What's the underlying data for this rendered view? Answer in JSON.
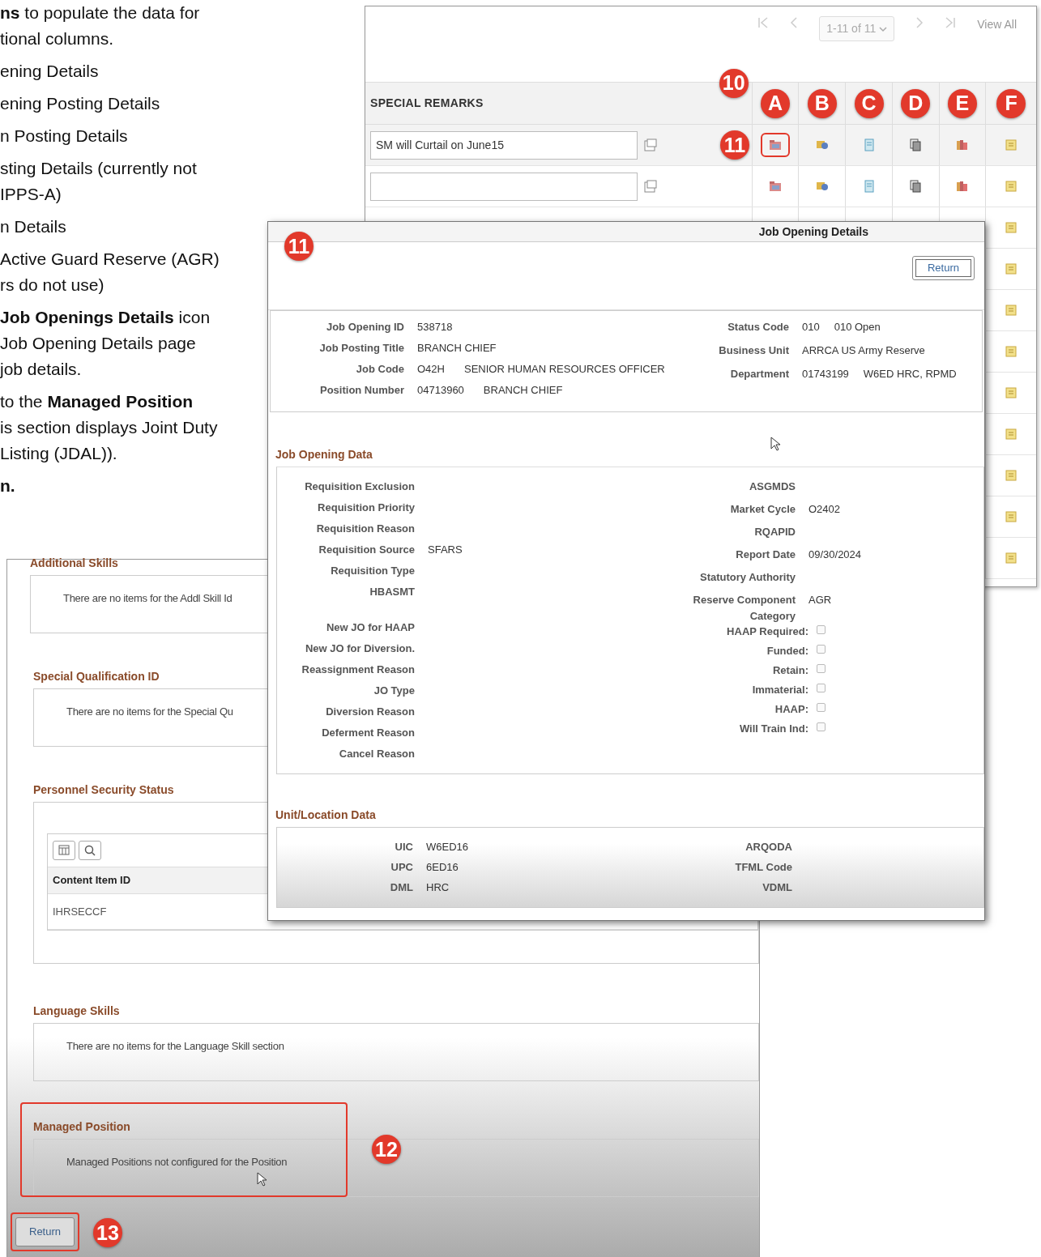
{
  "instructions": [
    {
      "lines": [
        "**ns** to populate the data for",
        "tional columns."
      ]
    },
    {
      "lines": [
        "ening Details"
      ]
    },
    {
      "lines": [
        "ening Posting Details"
      ]
    },
    {
      "lines": [
        "n Posting Details"
      ]
    },
    {
      "lines": [
        "sting Details (currently not",
        "IPPS-A)"
      ]
    },
    {
      "lines": [
        "n Details"
      ]
    },
    {
      "lines": [
        "Active Guard Reserve (AGR)",
        "rs do not use)"
      ]
    },
    {
      "lines": [
        "**Job Openings Details** icon",
        "Job Opening Details page",
        "job details."
      ]
    },
    {
      "lines": [
        "to the **Managed Position**",
        "is section displays Joint Duty",
        "Listing (JDAL))."
      ]
    },
    {
      "lines": [
        "**n.**"
      ]
    }
  ],
  "remarks_grid": {
    "pager": {
      "range": "1-11 of 11",
      "view_all": "View All"
    },
    "callout": "10",
    "header": "SPECIAL REMARKS",
    "columns": [
      "A",
      "B",
      "C",
      "D",
      "E",
      "F"
    ],
    "rows": [
      {
        "kind": "remark",
        "value": "SM will Curtail on June15",
        "callout": "11"
      },
      {
        "kind": "remark"
      },
      {
        "kind": "partial"
      },
      {
        "kind": "partial"
      },
      {
        "kind": "partial"
      },
      {
        "kind": "partial"
      },
      {
        "kind": "partial"
      },
      {
        "kind": "partial"
      },
      {
        "kind": "partial"
      },
      {
        "kind": "partial"
      },
      {
        "kind": "partial"
      }
    ]
  },
  "position_sections": {
    "sections": [
      {
        "title": "Additional Skills",
        "kind": "message",
        "message": "There are no items for the Addl Skill Id"
      },
      {
        "title": "Special Qualification ID",
        "kind": "message",
        "message": "There are no items for the Special Qu"
      },
      {
        "title": "Personnel Security Status",
        "kind": "grid",
        "column": "Content Item ID",
        "rows": [
          "IHRSECCF"
        ]
      },
      {
        "title": "Language Skills",
        "kind": "message",
        "message": "There are no items for the Language Skill section"
      },
      {
        "title": "Managed Position",
        "kind": "message",
        "message": "Managed Positions not configured for the Position",
        "callout": "12"
      }
    ],
    "return_button": {
      "label": "Return",
      "callout": "13"
    }
  },
  "job_opening_details": {
    "title": "Job Opening Details",
    "callout": "11",
    "return_button": "Return",
    "header_left": [
      {
        "label": "Job Opening ID",
        "values": [
          "538718"
        ]
      },
      {
        "label": "Job Posting Title",
        "values": [
          "BRANCH CHIEF"
        ]
      },
      {
        "label": "Job Code",
        "values": [
          "O42H",
          "SENIOR HUMAN RESOURCES OFFICER"
        ]
      },
      {
        "label": "Position Number",
        "values": [
          "04713960",
          "BRANCH CHIEF"
        ]
      }
    ],
    "header_right": [
      {
        "label": "Status Code",
        "values": [
          "010",
          "010 Open"
        ]
      },
      {
        "label": "Business Unit",
        "values": [
          "ARRCA US Army Reserve"
        ]
      },
      {
        "label": "Department",
        "values": [
          "01743199",
          "W6ED HRC, RPMD"
        ]
      }
    ],
    "job_opening_data": {
      "title": "Job Opening Data",
      "left": [
        {
          "label": "Requisition Exclusion"
        },
        {
          "label": "Requisition Priority"
        },
        {
          "label": "Requisition Reason"
        },
        {
          "label": "Requisition Source",
          "value": "SFARS"
        },
        {
          "label": "Requisition Type"
        },
        {
          "label": "HBASMT"
        },
        {
          "label": "New JO for HAAP"
        },
        {
          "label": "New JO for Diversion."
        },
        {
          "label": "Reassignment Reason"
        },
        {
          "label": "JO Type"
        },
        {
          "label": "Diversion Reason"
        },
        {
          "label": "Deferment Reason"
        },
        {
          "label": "Cancel Reason"
        }
      ],
      "right": [
        {
          "kind": "field",
          "label": "ASGMDS"
        },
        {
          "kind": "field",
          "label": "Market Cycle",
          "value": "O2402"
        },
        {
          "kind": "field",
          "label": "RQAPID"
        },
        {
          "kind": "field",
          "label": "Report Date",
          "value": "09/30/2024"
        },
        {
          "kind": "field",
          "label": "Statutory Authority"
        },
        {
          "kind": "field",
          "label": "Reserve Component Category",
          "value": "AGR"
        },
        {
          "kind": "checkbox",
          "label": "HAAP Required:",
          "checked": false
        },
        {
          "kind": "checkbox",
          "label": "Funded:",
          "checked": false
        },
        {
          "kind": "checkbox",
          "label": "Retain:",
          "checked": false
        },
        {
          "kind": "checkbox",
          "label": "Immaterial:",
          "checked": false
        },
        {
          "kind": "checkbox",
          "label": "HAAP:",
          "checked": false
        },
        {
          "kind": "checkbox",
          "label": "Will Train Ind:",
          "checked": false
        }
      ]
    },
    "unit_location_data": {
      "title": "Unit/Location Data",
      "left": [
        {
          "label": "UIC",
          "value": "W6ED16"
        },
        {
          "label": "UPC",
          "value": "6ED16"
        },
        {
          "label": "DML",
          "value": "HRC"
        }
      ],
      "right": [
        {
          "label": "ARQODA"
        },
        {
          "label": "TFML Code"
        },
        {
          "label": "VDML"
        }
      ]
    }
  }
}
